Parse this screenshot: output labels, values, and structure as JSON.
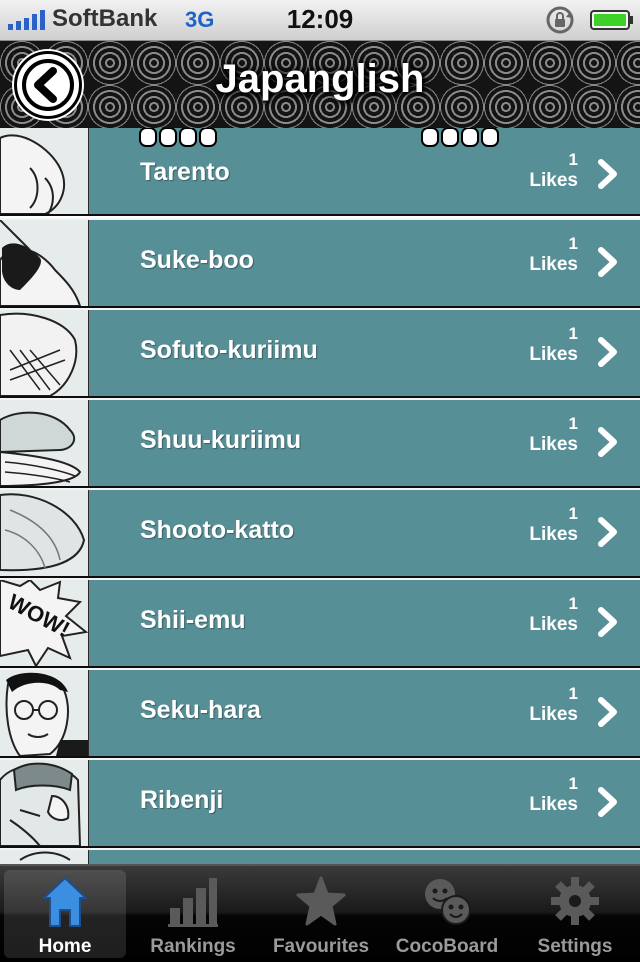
{
  "status_bar": {
    "carrier": "SoftBank",
    "network": "3G",
    "time": "12:09"
  },
  "nav": {
    "title": "Japanglish",
    "back_icon": "back-arrow-icon"
  },
  "list": {
    "items": [
      {
        "label": "Tarento",
        "likes_count": "1",
        "likes_label": "Likes"
      },
      {
        "label": "Suke-boo",
        "likes_count": "1",
        "likes_label": "Likes"
      },
      {
        "label": "Sofuto-kuriimu",
        "likes_count": "1",
        "likes_label": "Likes"
      },
      {
        "label": "Shuu-kuriimu",
        "likes_count": "1",
        "likes_label": "Likes"
      },
      {
        "label": "Shooto-katto",
        "likes_count": "1",
        "likes_label": "Likes"
      },
      {
        "label": "Shii-emu",
        "likes_count": "1",
        "likes_label": "Likes"
      },
      {
        "label": "Seku-hara",
        "likes_count": "1",
        "likes_label": "Likes"
      },
      {
        "label": "Ribenji",
        "likes_count": "1",
        "likes_label": "Likes"
      }
    ],
    "thumb_text": "WOW!"
  },
  "tabs": [
    {
      "label": "Home",
      "icon": "home-icon",
      "active": true
    },
    {
      "label": "Rankings",
      "icon": "rankings-icon",
      "active": false
    },
    {
      "label": "Favourites",
      "icon": "star-icon",
      "active": false
    },
    {
      "label": "CocoBoard",
      "icon": "cocoboard-icon",
      "active": false
    },
    {
      "label": "Settings",
      "icon": "gear-icon",
      "active": false
    }
  ],
  "colors": {
    "row_bg": "#578f96",
    "network": "#1f63c9",
    "home_icon": "#3c8ee0"
  }
}
